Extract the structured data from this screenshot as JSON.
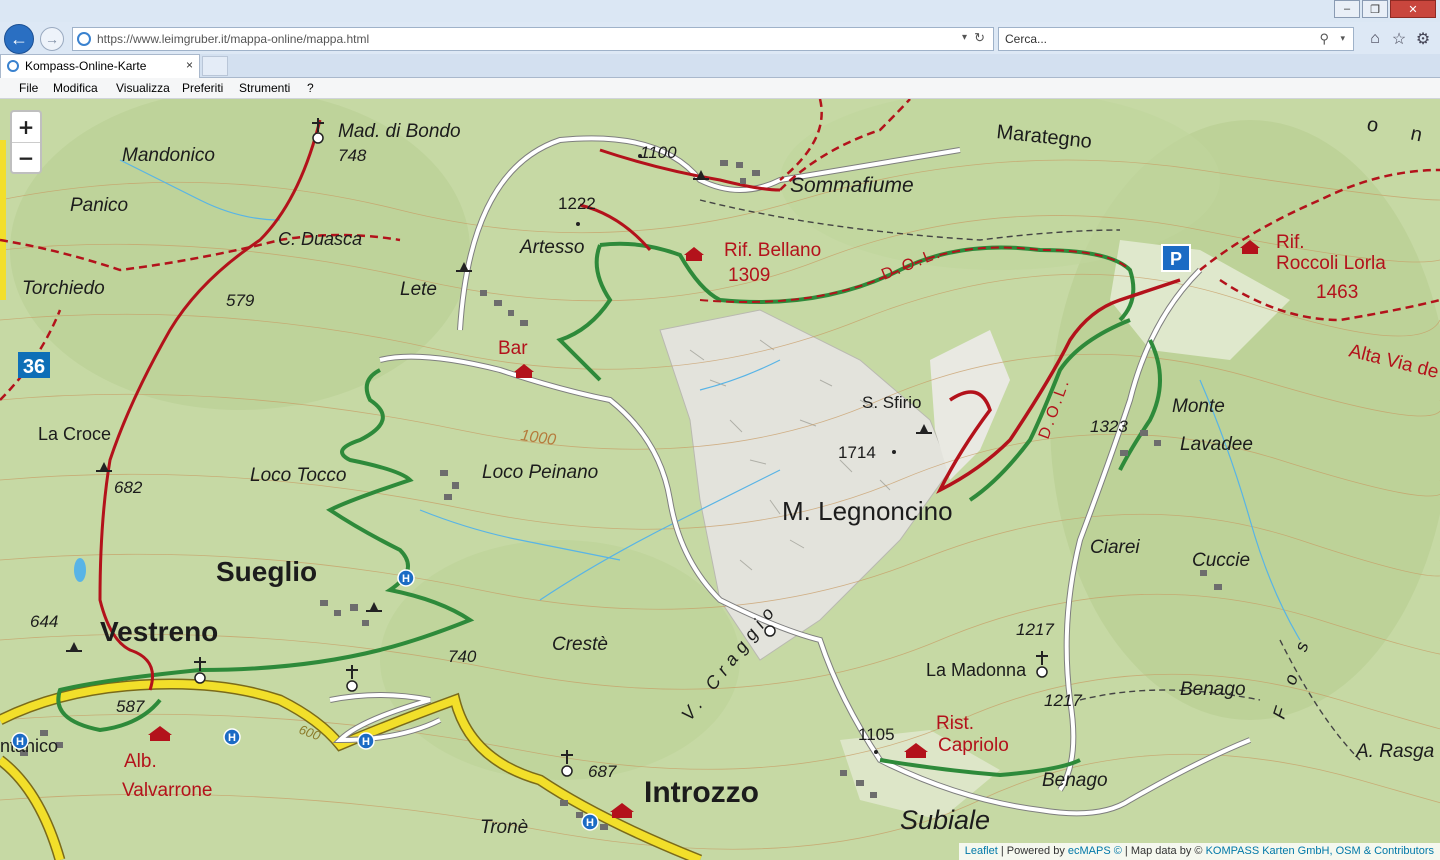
{
  "browser": {
    "window_controls": [
      "minimize",
      "restore",
      "close"
    ],
    "url": "https://www.leimgruber.it/mappa-online/mappa.html",
    "search_placeholder": "Cerca...",
    "tab_title": "Kompass-Online-Karte",
    "tab_close": "×",
    "menu": [
      "File",
      "Modifica",
      "Visualizza",
      "Preferiti",
      "Strumenti",
      "?"
    ],
    "toolbar_icons": [
      "home-icon",
      "star-icon",
      "gear-icon"
    ]
  },
  "map": {
    "zoom_in": "+",
    "zoom_out": "−",
    "labels": {
      "mad_di_bondo": "Mad. di Bondo",
      "mad_di_bondo_elev": "748",
      "mandonico": "Mandonico",
      "panico": "Panico",
      "c_duasca": "C. Duasca",
      "torchiedo": "Torchiedo",
      "elev_579": "579",
      "road_36": "36",
      "la_croce": "La Croce",
      "elev_682": "682",
      "elev_644": "644",
      "vestreno": "Vestreno",
      "elev_587": "587",
      "ntanico": "ntanico",
      "alb": "Alb.",
      "valvarrone": "Valvarrone",
      "sueglio": "Sueglio",
      "loco_tocco": "Loco Tocco",
      "loco_peinano": "Loco Peinano",
      "lete": "Lete",
      "artesso": "Artesso",
      "elev_1222": "1222",
      "elev_1100": "1100",
      "bar": "Bar",
      "contour_1000": "1000",
      "sommafiume": "Sommafiume",
      "marategno": "Marategno",
      "rif_bellano": "Rif. Bellano",
      "rif_bellano_elev": "1309",
      "dol_1": "D.O.L.",
      "dol_2": "D.O.L.",
      "rif_roccoli_1": "Rif.",
      "rif_roccoli_2": "Roccoli Lorla",
      "rif_roccoli_elev": "1463",
      "alta_via": "Alta Via de",
      "on": "o n",
      "s_sfirio": "S. Sfirio",
      "elev_1714": "1714",
      "m_legnoncino": "M. Legnoncino",
      "elev_1323": "1323",
      "monte": "Monte",
      "lavadee": "Lavadee",
      "ciarei": "Ciarei",
      "cuccie": "Cuccie",
      "creste": "Crestè",
      "elev_740": "740",
      "v_craggio": "V. Craggio",
      "elev_1217a": "1217",
      "la_madonna": "La Madonna",
      "elev_1217b": "1217",
      "benago_1": "Benago",
      "elev_1105": "1105",
      "rist": "Rist.",
      "capriolo": "Capriolo",
      "benago_2": "Benago",
      "subiale": "Subiale",
      "introzzo": "Introzzo",
      "elev_687": "687",
      "trone": "Tronè",
      "a_rasga": "A. Rasga",
      "fos": "F o s",
      "elev_600": "600",
      "parking": "P",
      "h_stop": "H"
    },
    "colors": {
      "terrain": "#c6d9a4",
      "hiking_trail": "#2e8a3a",
      "red_trail": "#b3121b",
      "road_yellow": "#f2df2a",
      "road_white": "#ffffff",
      "label_red": "#b3121b",
      "water": "#58b4e6"
    }
  },
  "attribution": {
    "leaflet": "Leaflet",
    "powered_by": " | Powered by ",
    "ecmaps": "ecMAPS ©",
    "map_data": " | Map data by © ",
    "kompass": "KOMPASS Karten GmbH, OSM & Contributors"
  }
}
